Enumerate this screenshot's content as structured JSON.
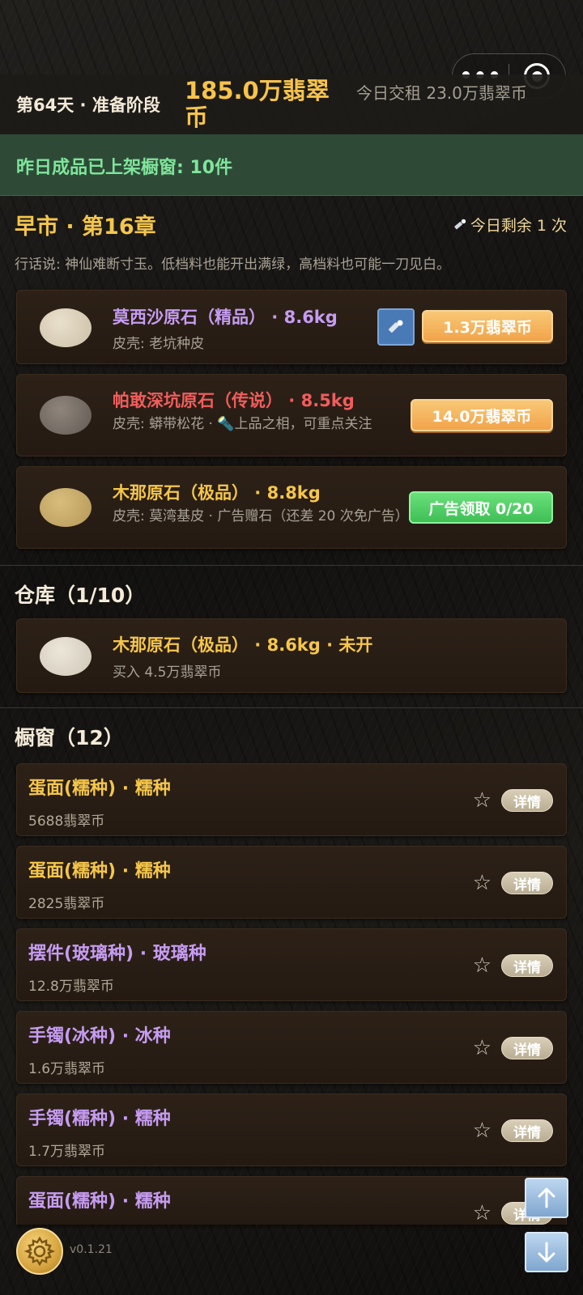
{
  "header": {
    "day_phase": "第64天 · 准备阶段",
    "coins": "185.0万翡翠币",
    "rent": "今日交租  23.0万翡翠币"
  },
  "notice": "昨日成品已上架橱窗: 10件",
  "market": {
    "title": "早市 · 第16章",
    "remaining": "今日剩余  1  次",
    "saying": "行话说: 神仙难断寸玉。低档料也能开出满绿，高档料也可能一刀见白。",
    "stones": [
      {
        "name": "莫西沙原石（精品） · 8.6kg",
        "sub": "皮壳: 老坑种皮",
        "button": "1.3万翡翠币",
        "stone_color": "#d8cdb7",
        "name_color": "#c69cf2"
      },
      {
        "name": "帕敢深坑原石（传说） · 8.5kg",
        "sub": "皮壳: 蟒带松花 · 🔦上品之相，可重点关注",
        "button": "14.0万翡翠币",
        "stone_color": "#7a716a",
        "name_color": "#f15d5d"
      },
      {
        "name": "木那原石（极品） · 8.8kg",
        "sub": "皮壳: 莫湾基皮 · 广告赠石（还差 20 次免广告）",
        "button": "广告领取 0/20",
        "stone_color": "#c9ad6e",
        "name_color": "#f5c64a"
      }
    ]
  },
  "warehouse": {
    "title": "仓库（1/10）",
    "items": [
      {
        "name": "木那原石（极品） · 8.6kg · 未开",
        "sub": "买入  4.5万翡翠币",
        "stone_color": "#ded6c7"
      }
    ]
  },
  "showcase": {
    "title": "橱窗（12）",
    "detail_label": "详情",
    "items": [
      {
        "name": "蛋面(糯种) · 糯种",
        "price": "5688翡翠币",
        "color": "#f5c64a"
      },
      {
        "name": "蛋面(糯种) · 糯种",
        "price": "2825翡翠币",
        "color": "#f5c64a"
      },
      {
        "name": "摆件(玻璃种) · 玻璃种",
        "price": "12.8万翡翠币",
        "color": "#c69cf2"
      },
      {
        "name": "手镯(冰种) · 冰种",
        "price": "1.6万翡翠币",
        "color": "#c69cf2"
      },
      {
        "name": "手镯(糯种) · 糯种",
        "price": "1.7万翡翠币",
        "color": "#c69cf2"
      },
      {
        "name": "蛋面(糯种) · 糯种",
        "price": "",
        "color": "#c69cf2"
      }
    ]
  },
  "footer": {
    "version": "v0.1.21"
  },
  "icons": [
    "more-dots-icon",
    "target-icon",
    "torch-icon",
    "star-icon",
    "gear-icon",
    "arrow-up-icon",
    "arrow-down-icon"
  ]
}
